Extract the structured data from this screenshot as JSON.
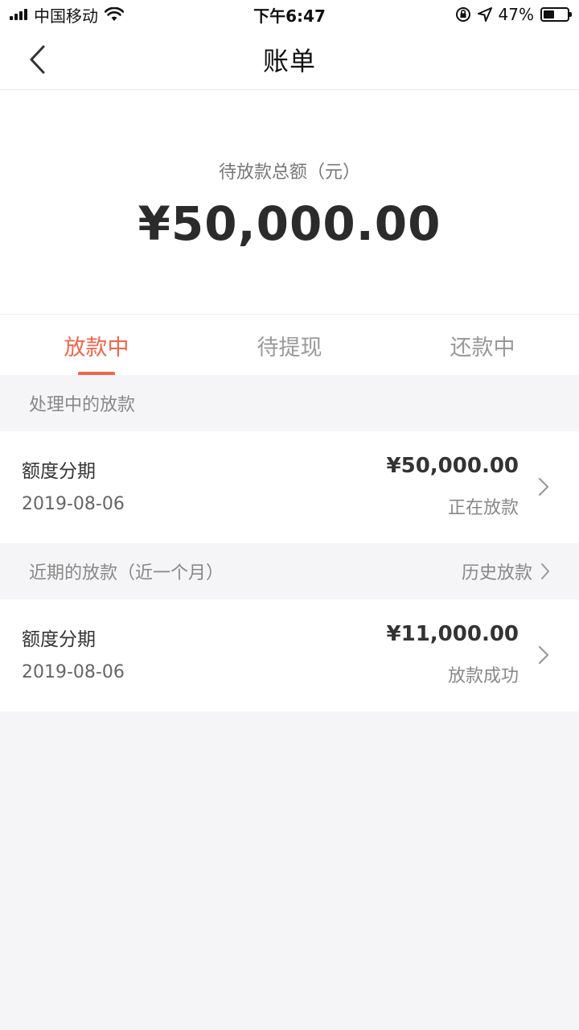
{
  "status_bar": {
    "carrier": "中国移动",
    "time": "下午6:47",
    "battery_percent": "47%",
    "battery_level": 0.47
  },
  "nav": {
    "title": "账单",
    "back_icon": "chevron-left-icon"
  },
  "summary": {
    "label": "待放款总额（元）",
    "amount": "¥50,000.00"
  },
  "tabs": [
    {
      "label": "放款中",
      "active": true
    },
    {
      "label": "待提现",
      "active": false
    },
    {
      "label": "还款中",
      "active": false
    }
  ],
  "processing_section": {
    "title": "处理中的放款",
    "items": [
      {
        "name": "额度分期",
        "date": "2019-08-06",
        "amount": "¥50,000.00",
        "status": "正在放款"
      }
    ]
  },
  "recent_section": {
    "title": "近期的放款（近一个月）",
    "history_label": "历史放款",
    "items": [
      {
        "name": "额度分期",
        "date": "2019-08-06",
        "amount": "¥11,000.00",
        "status": "放款成功"
      }
    ]
  },
  "colors": {
    "accent": "#f0664a",
    "background": "#f5f5f7",
    "text_primary": "#333333",
    "text_secondary": "#888888"
  }
}
